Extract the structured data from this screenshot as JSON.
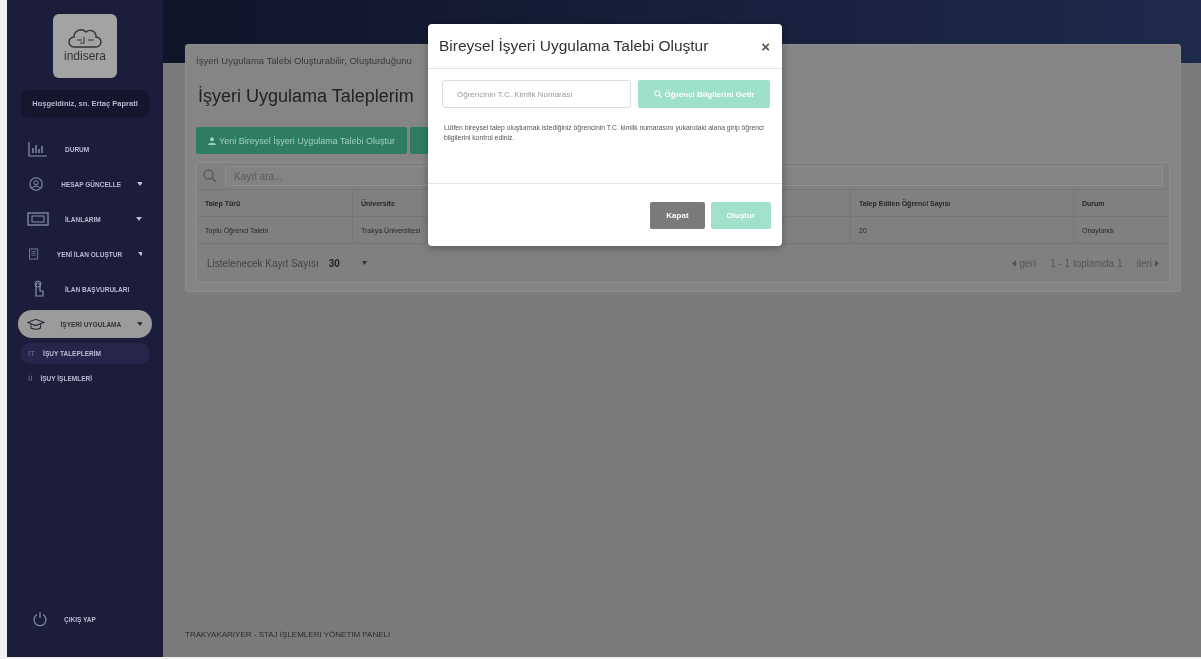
{
  "sidebar": {
    "logo": {
      "text": "indisera"
    },
    "welcome": "Hoşgeldiniz, sn. Ertaç Papratl",
    "items": [
      {
        "label": "DURUM",
        "kind": "chart",
        "expandable": false,
        "selected": false
      },
      {
        "label": "HESAP GÜNCELLE",
        "kind": "user",
        "expandable": true,
        "selected": false
      },
      {
        "label": "İLANLARIM",
        "kind": "card",
        "expandable": true,
        "selected": false
      },
      {
        "label": "YENİ İLAN OLUŞTUR",
        "kind": "doc",
        "expandable": true,
        "selected": false
      },
      {
        "label": "İLAN BAŞVURULARI",
        "kind": "hand",
        "expandable": false,
        "selected": false
      },
      {
        "label": "İŞYERİ UYGULAMA",
        "kind": "cap",
        "expandable": true,
        "selected": true,
        "children": [
          {
            "prefix": "İT",
            "label": "İŞUY TALEPLERİM",
            "selected": true
          },
          {
            "prefix": "İİ",
            "label": "İŞUY İŞLEMLERİ",
            "selected": false
          }
        ]
      }
    ],
    "logout": "ÇIKIŞ YAP"
  },
  "page": {
    "subtitle": "İşyeri Uygulama Talebi Oluşturabilir, Oluşturduğunu",
    "title": "İşyeri Uygulama Taleplerim",
    "buttons": [
      {
        "kind": "new",
        "label": "Yeni Bireysel İşyeri Uygulama Talebi Oluştur"
      },
      {
        "kind": "other"
      }
    ],
    "search": {
      "placeholder": "Kayıt ara..."
    },
    "table": {
      "columns": [
        "Talep Türü",
        "Üniversite",
        "",
        "",
        "Talep Edilen Öğrenci Sayısı",
        "Durum"
      ],
      "rows": [
        [
          "Toplu Öğrenci Talebi",
          "Trakya Üniversitesi",
          "",
          "",
          "20",
          "Onaylandı"
        ]
      ]
    },
    "page_size": {
      "label": "Listelenecek Kayıt Sayısı",
      "value": "30"
    },
    "pagination": {
      "prev": "geri",
      "info": "1 - 1 toplamda 1",
      "next": "ileri"
    }
  },
  "footer": "TRAKYAKARIYER - STAJ İŞLEMLERI YÖNETIM PANELI",
  "modal": {
    "title": "Bireysel İşyeri Uygulama Talebi Oluştur",
    "close": "×",
    "id_field": {
      "placeholder": "Öğrencinin T.C. Kimlik Numarası"
    },
    "fetch_button": {
      "label": "Öğrenci Bilgilerini Getir",
      "disabled": true
    },
    "help": "Lütfen bireysel talep oluşturmak istediğiniz öğrencinin T.C. kimlik numarasını yukarıdaki alana girip öğrenci bilgilerini kontrol ediniz.",
    "buttons": [
      {
        "label": "Kapat",
        "kind": "secondary"
      },
      {
        "label": "Oluştur",
        "kind": "primary",
        "disabled": true
      }
    ]
  }
}
